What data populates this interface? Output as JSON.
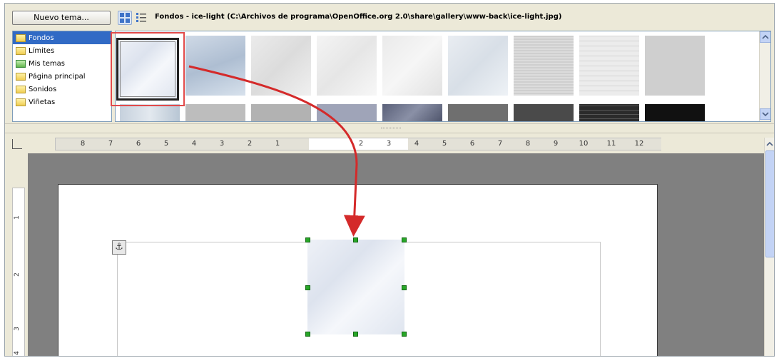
{
  "gallery": {
    "new_theme_label": "Nuevo tema...",
    "path_title": "Fondos - ice-light (C:\\Archivos de programa\\OpenOffice.org 2.0\\share\\gallery\\www-back\\ice-light.jpg)",
    "themes": [
      {
        "label": "Fondos",
        "selected": true
      },
      {
        "label": "Límites",
        "selected": false
      },
      {
        "label": "Mis temas",
        "selected": false
      },
      {
        "label": "Página principal",
        "selected": false
      },
      {
        "label": "Sonidos",
        "selected": false
      },
      {
        "label": "Viñetas",
        "selected": false
      }
    ]
  },
  "ruler": {
    "left_labels": [
      "8",
      "7",
      "6",
      "5",
      "4",
      "3",
      "2",
      "1"
    ],
    "right_labels": [
      "2",
      "3",
      "4",
      "5",
      "6",
      "7",
      "8",
      "9",
      "10",
      "11",
      "12"
    ],
    "vertical_labels": [
      "1",
      "2",
      "3",
      "4"
    ]
  },
  "icons": {
    "anchor": "anchor-icon",
    "arrow_up": "arrow-up-icon",
    "arrow_down": "arrow-down-icon",
    "icon_view": "icon-view-icon",
    "detail_view": "detail-view-icon"
  },
  "colors": {
    "highlight_red": "#e24a4a",
    "selection_blue": "#316ac5",
    "handle_green": "#27a627"
  }
}
